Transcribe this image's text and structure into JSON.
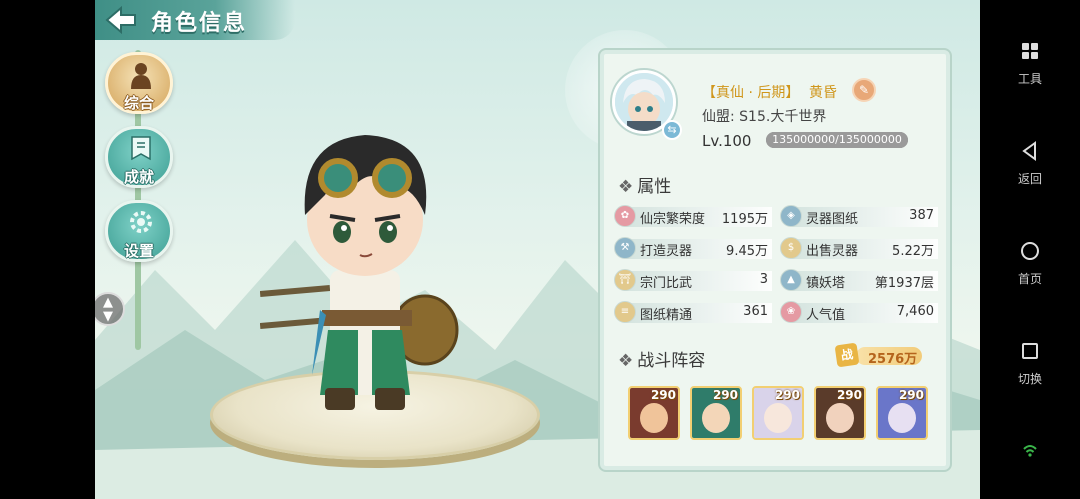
{
  "header": {
    "title": "角色信息"
  },
  "nav": {
    "items": [
      {
        "label": "综合",
        "active": true
      },
      {
        "label": "成就",
        "active": false
      },
      {
        "label": "设置",
        "active": false
      }
    ]
  },
  "profile": {
    "rank": "【真仙 · 后期】",
    "name": "黄昏",
    "alliance": "仙盟: S15.大千世界",
    "level": "Lv.100",
    "exp_text": "135000000/135000000",
    "exp_fraction": 1.0
  },
  "attributes": {
    "title": "属性",
    "items": [
      {
        "label": "仙宗繁荣度",
        "value": "1195万",
        "icon": "lotus-icon",
        "color": "#e59aa3"
      },
      {
        "label": "灵器图纸",
        "value": "387",
        "icon": "blueprint-icon",
        "color": "#8fb6c9"
      },
      {
        "label": "打造灵器",
        "value": "9.45万",
        "icon": "forge-icon",
        "color": "#8fb6c9"
      },
      {
        "label": "出售灵器",
        "value": "5.22万",
        "icon": "money-bag-icon",
        "color": "#e2c98c"
      },
      {
        "label": "宗门比武",
        "value": "3",
        "icon": "gate-icon",
        "color": "#e2c98c"
      },
      {
        "label": "镇妖塔",
        "value": "第1937层",
        "icon": "tower-icon",
        "color": "#8fb6c9"
      },
      {
        "label": "图纸精通",
        "value": "361",
        "icon": "scroll-icon",
        "color": "#e2c98c"
      },
      {
        "label": "人气值",
        "value": "7,460",
        "icon": "flower-icon",
        "color": "#e59aa3"
      }
    ]
  },
  "lineup": {
    "title": "战斗阵容",
    "power_badge": "战",
    "power": "2576万",
    "heroes": [
      {
        "level": "290",
        "colors": [
          "#7a3b2e",
          "#f0c49a"
        ]
      },
      {
        "level": "290",
        "colors": [
          "#2f7c6a",
          "#f3d6b8"
        ]
      },
      {
        "level": "290",
        "colors": [
          "#d9d3ea",
          "#f7e7dc"
        ]
      },
      {
        "level": "290",
        "colors": [
          "#5a3b2a",
          "#f1d2bd"
        ]
      },
      {
        "level": "290",
        "colors": [
          "#6a76c9",
          "#e7e0f2"
        ]
      }
    ]
  },
  "system_nav": {
    "tools": "工具",
    "back": "返回",
    "home": "首页",
    "switch": "切换"
  }
}
